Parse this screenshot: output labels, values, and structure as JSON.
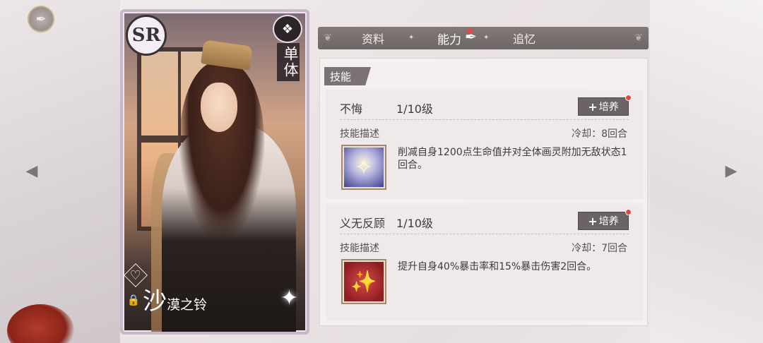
{
  "nav": {
    "top_button_icon": "feather-back-icon",
    "prev_icon": "arrow-left-icon",
    "next_icon": "arrow-right-icon"
  },
  "card": {
    "rarity": "SR",
    "type_label": "单体",
    "name_big": "沙",
    "name_rest": "漠之铃"
  },
  "tabs": [
    {
      "label": "资料",
      "active": false
    },
    {
      "label": "能力",
      "active": true
    },
    {
      "label": "追忆",
      "active": false
    }
  ],
  "section_title": "技能",
  "skills": [
    {
      "name": "不悔",
      "level": "1/10级",
      "train_label": "培养",
      "desc_label": "技能描述",
      "cooldown": "冷却：8回合",
      "description": "削减自身1200点生命值并对全体画灵附加无敌状态1回合。",
      "icon": "angel-icon"
    },
    {
      "name": "义无反顾",
      "level": "1/10级",
      "train_label": "培养",
      "desc_label": "技能描述",
      "cooldown": "冷却：7回合",
      "description": "提升自身40%暴击率和15%暴击伤害2回合。",
      "icon": "crit-star-icon"
    }
  ],
  "colors": {
    "accent_red": "#e24b3f",
    "tab_bar": "#7b7373",
    "panel_bg": "#f5f0f0"
  }
}
